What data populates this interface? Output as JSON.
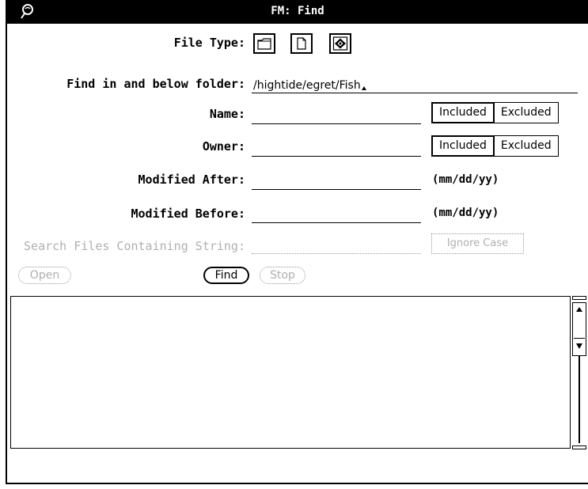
{
  "window": {
    "title": "FM: Find",
    "menu_icon": "window-menu-icon"
  },
  "file_type": {
    "label": "File Type:",
    "options": [
      {
        "name": "folder",
        "icon": "folder-icon",
        "selected": false
      },
      {
        "name": "document",
        "icon": "document-icon",
        "selected": false
      },
      {
        "name": "application",
        "icon": "application-icon",
        "selected": true
      }
    ]
  },
  "folder": {
    "label": "Find in and below folder:",
    "value": "/hightide/egret/Fish"
  },
  "name": {
    "label": "Name:",
    "value": "",
    "included": "Included",
    "excluded": "Excluded"
  },
  "owner": {
    "label": "Owner:",
    "value": "",
    "included": "Included",
    "excluded": "Excluded"
  },
  "modified_after": {
    "label": "Modified After:",
    "value": "",
    "format": "(mm/dd/yy)"
  },
  "modified_before": {
    "label": "Modified Before:",
    "value": "",
    "format": "(mm/dd/yy)"
  },
  "search_string": {
    "label": "Search Files Containing String:",
    "value": "",
    "ignore_case": "Ignore Case",
    "enabled": false
  },
  "buttons": {
    "open": "Open",
    "find": "Find",
    "stop": "Stop"
  },
  "results": {
    "items": []
  }
}
